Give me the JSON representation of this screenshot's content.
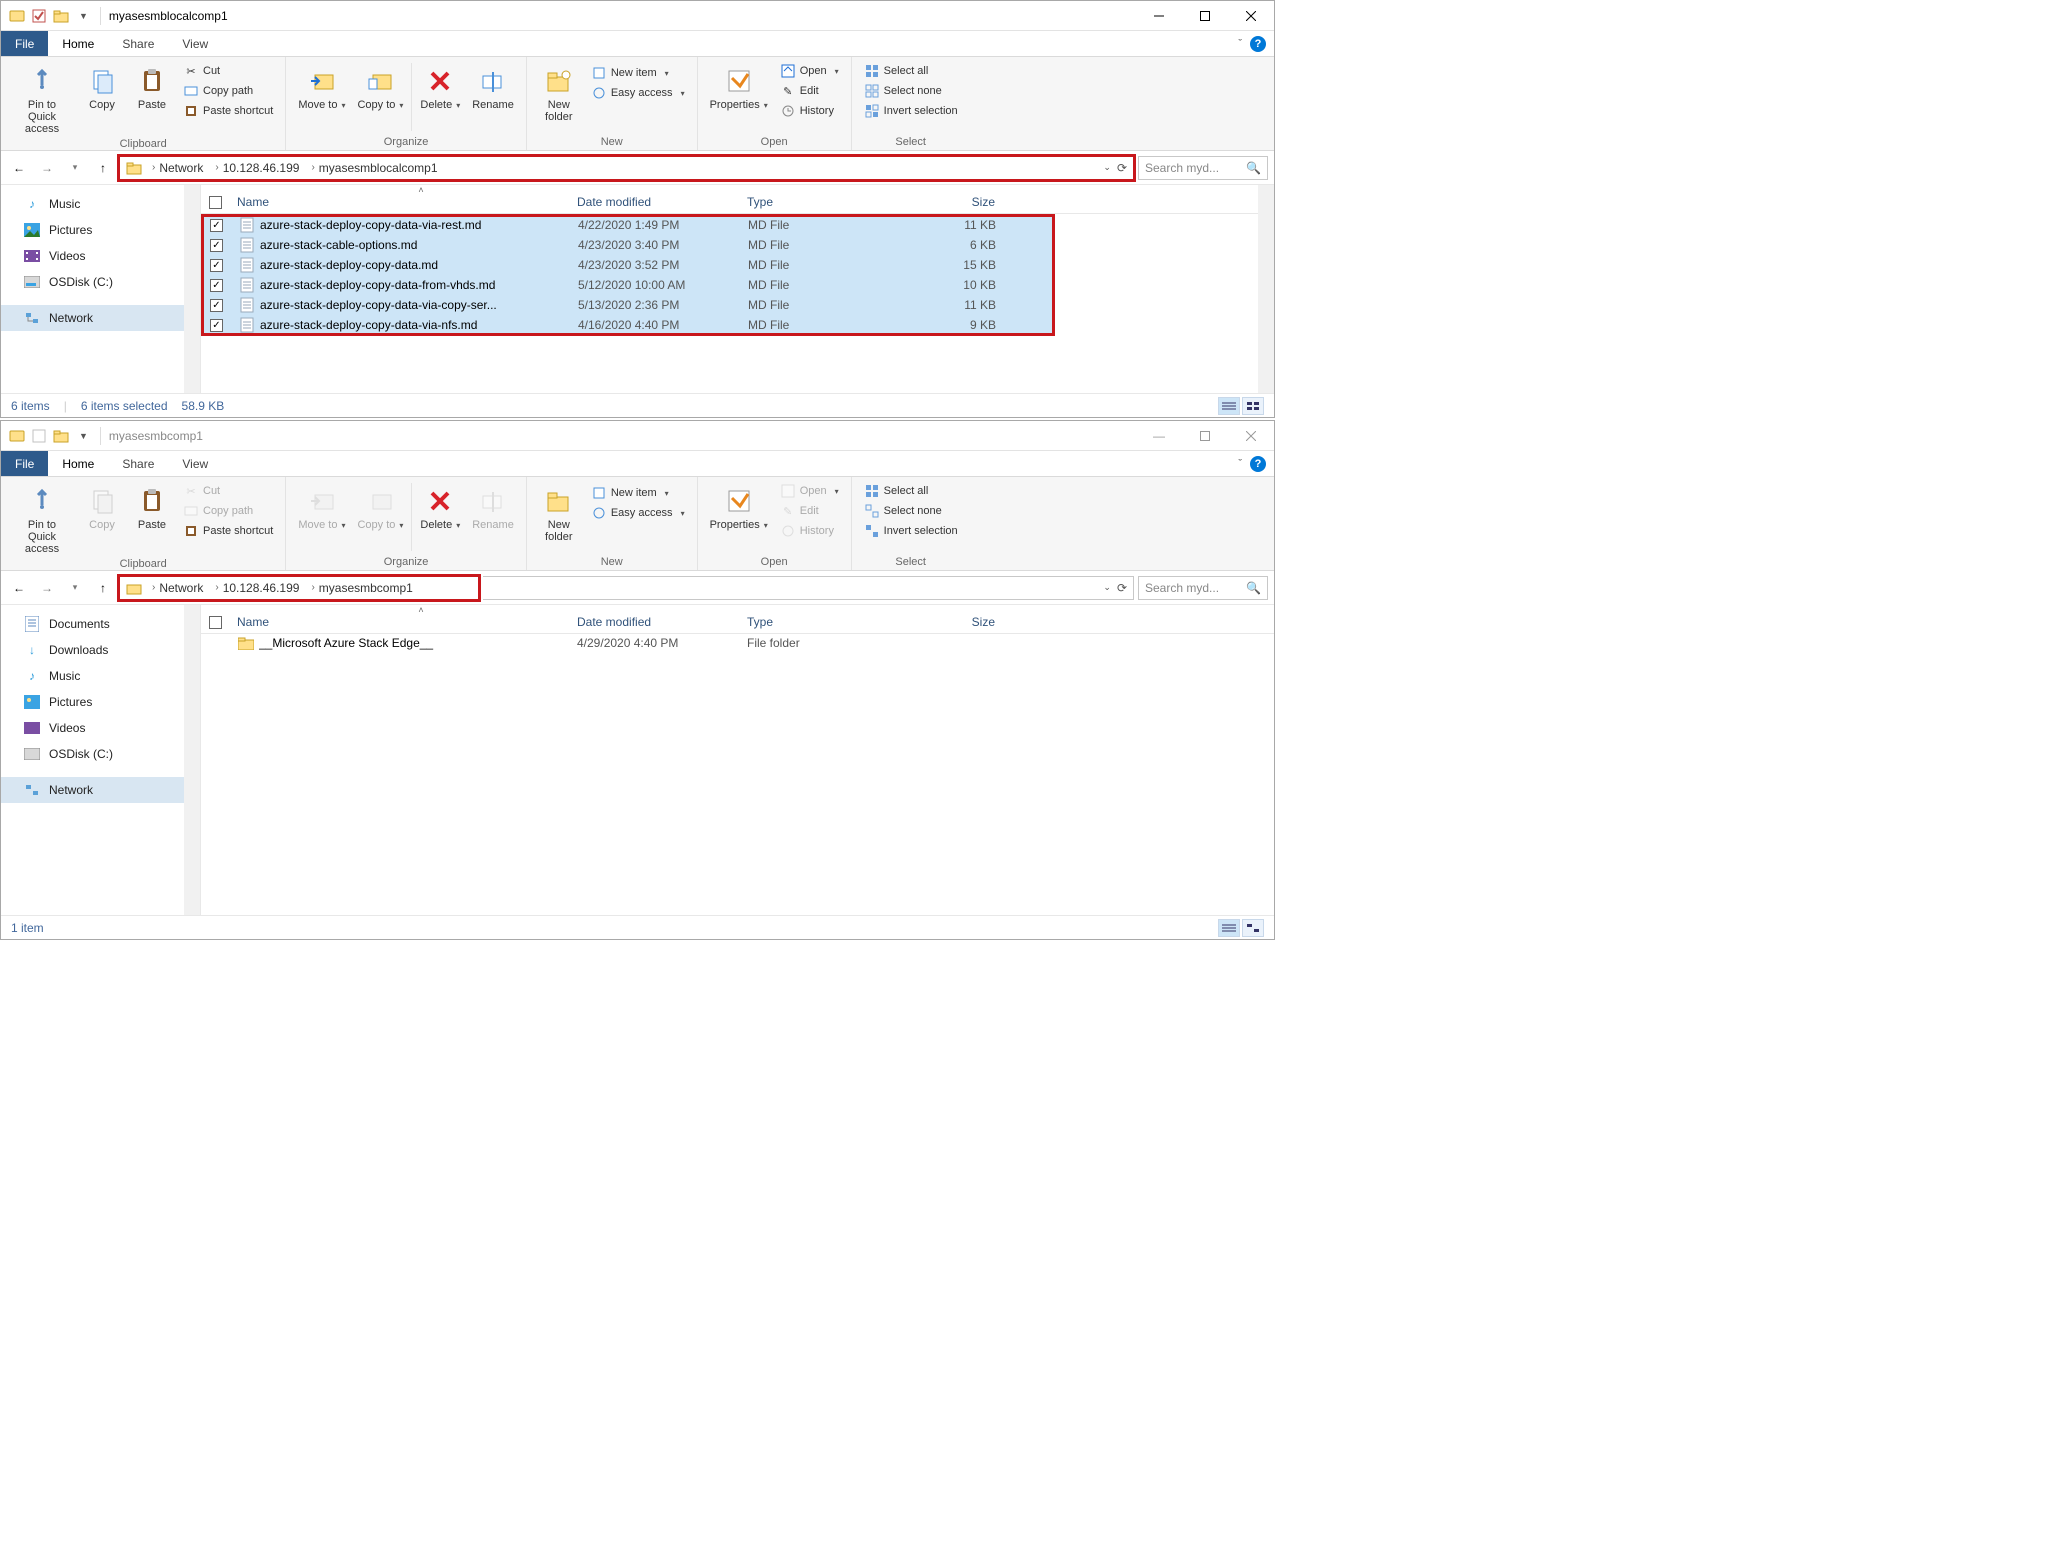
{
  "window1": {
    "title": "myasesmblocalcomp1",
    "tabs": {
      "file": "File",
      "home": "Home",
      "share": "Share",
      "view": "View"
    },
    "ribbon": {
      "clipboard": {
        "label": "Clipboard",
        "pin": "Pin to Quick access",
        "copy": "Copy",
        "paste": "Paste",
        "cut": "Cut",
        "copy_path": "Copy path",
        "paste_shortcut": "Paste shortcut"
      },
      "organize": {
        "label": "Organize",
        "move_to": "Move to",
        "copy_to": "Copy to",
        "delete": "Delete",
        "rename": "Rename"
      },
      "new": {
        "label": "New",
        "new_folder": "New folder",
        "new_item": "New item",
        "easy_access": "Easy access"
      },
      "open": {
        "label": "Open",
        "properties": "Properties",
        "open": "Open",
        "edit": "Edit",
        "history": "History"
      },
      "select": {
        "label": "Select",
        "select_all": "Select all",
        "select_none": "Select none",
        "invert": "Invert selection"
      }
    },
    "breadcrumb": [
      "Network",
      "10.128.46.199",
      "myasesmblocalcomp1"
    ],
    "search_placeholder": "Search myd...",
    "nav": [
      "Music",
      "Pictures",
      "Videos",
      "OSDisk (C:)",
      "Network"
    ],
    "columns": {
      "name": "Name",
      "date": "Date modified",
      "type": "Type",
      "size": "Size"
    },
    "files": [
      {
        "name": "azure-stack-deploy-copy-data-via-rest.md",
        "date": "4/22/2020 1:49 PM",
        "type": "MD File",
        "size": "11 KB"
      },
      {
        "name": "azure-stack-cable-options.md",
        "date": "4/23/2020 3:40 PM",
        "type": "MD File",
        "size": "6 KB"
      },
      {
        "name": "azure-stack-deploy-copy-data.md",
        "date": "4/23/2020 3:52 PM",
        "type": "MD File",
        "size": "15 KB"
      },
      {
        "name": "azure-stack-deploy-copy-data-from-vhds.md",
        "date": "5/12/2020 10:00 AM",
        "type": "MD File",
        "size": "10 KB"
      },
      {
        "name": "azure-stack-deploy-copy-data-via-copy-ser...",
        "date": "5/13/2020 2:36 PM",
        "type": "MD File",
        "size": "11 KB"
      },
      {
        "name": "azure-stack-deploy-copy-data-via-nfs.md",
        "date": "4/16/2020 4:40 PM",
        "type": "MD File",
        "size": "9 KB"
      }
    ],
    "status": {
      "count": "6 items",
      "selected": "6 items selected",
      "size": "58.9 KB"
    }
  },
  "window2": {
    "title": "myasesmbcomp1",
    "tabs": {
      "file": "File",
      "home": "Home",
      "share": "Share",
      "view": "View"
    },
    "breadcrumb": [
      "Network",
      "10.128.46.199",
      "myasesmbcomp1"
    ],
    "search_placeholder": "Search myd...",
    "nav": [
      "Documents",
      "Downloads",
      "Music",
      "Pictures",
      "Videos",
      "OSDisk (C:)",
      "Network"
    ],
    "columns": {
      "name": "Name",
      "date": "Date modified",
      "type": "Type",
      "size": "Size"
    },
    "files": [
      {
        "name": "__Microsoft Azure Stack Edge__",
        "date": "4/29/2020 4:40 PM",
        "type": "File folder",
        "size": ""
      }
    ],
    "status": {
      "count": "1 item"
    }
  }
}
